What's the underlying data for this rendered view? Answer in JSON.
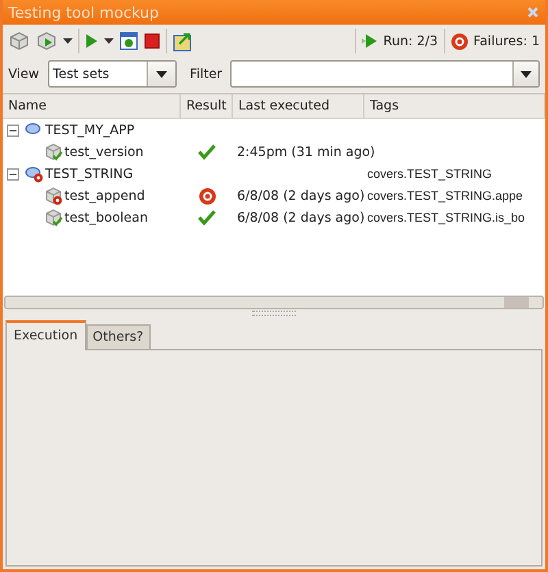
{
  "window": {
    "title": "Testing tool mockup"
  },
  "toolbar": {
    "run_status": "Run: 2/3",
    "failures": "Failures: 1"
  },
  "view": {
    "label": "View",
    "value": "Test sets"
  },
  "filter": {
    "label": "Filter"
  },
  "table": {
    "columns": [
      "Name",
      "Result",
      "Last executed",
      "Tags"
    ],
    "rows": [
      {
        "name": "TEST_MY_APP",
        "kind": "group",
        "expanded": true,
        "failed": false,
        "children": [
          {
            "name": "test_version",
            "kind": "test",
            "failed": false,
            "last_executed": "2:45pm (31 min ago)"
          }
        ]
      },
      {
        "name": "TEST_STRING",
        "kind": "group",
        "expanded": true,
        "failed": true,
        "tags": "covers.TEST_STRING",
        "children": [
          {
            "name": "test_append",
            "kind": "test",
            "failed": true,
            "last_executed": "6/8/08 (2 days ago)",
            "tags": "covers.TEST_STRING.appe"
          },
          {
            "name": "test_boolean",
            "kind": "test",
            "failed": false,
            "last_executed": "6/8/08 (2 days ago)",
            "tags": "covers.TEST_STRING.is_bo"
          }
        ]
      }
    ]
  },
  "tabs": [
    {
      "label": "Execution",
      "selected": true
    },
    {
      "label": "Others?",
      "selected": false
    }
  ]
}
